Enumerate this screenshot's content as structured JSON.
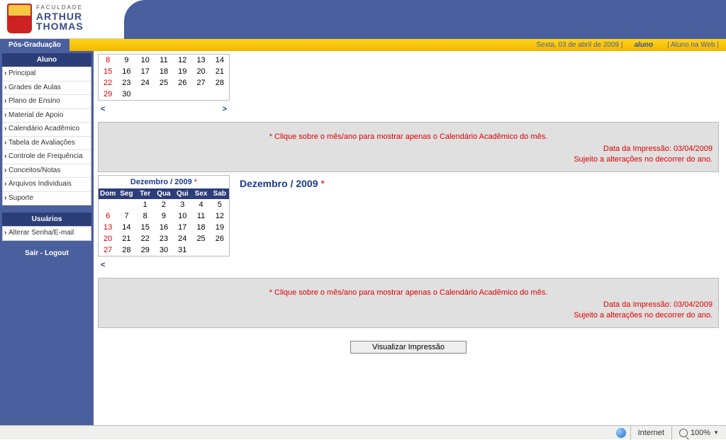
{
  "brand": {
    "small": "FACULDADE",
    "line1": "ARTHUR",
    "line2": "THOMAS"
  },
  "section_label": "Pós-Graduação",
  "topbar": {
    "date": "Sexta, 03 de abril de 2009 |",
    "aluno_tag": "aluno",
    "aluno_web": "| Aluno na Web |"
  },
  "sidebar": {
    "blocks": [
      {
        "title": "Aluno",
        "items": [
          "Principal",
          "Grades de Aulas",
          "Plano de Ensino",
          "Material de Apoio",
          "Calendário Acadêmico",
          "Tabela de Avaliações",
          "Controle de Frequência",
          "Conceitos/Notas",
          "Arquivos Individuais",
          "Suporte"
        ]
      },
      {
        "title": "Usuários",
        "items": [
          "Alterar Senha/E-mail"
        ]
      }
    ],
    "logout": "Sair - Logout"
  },
  "cal1": {
    "weeks": [
      [
        "8",
        "9",
        "10",
        "11",
        "12",
        "13",
        "14"
      ],
      [
        "15",
        "16",
        "17",
        "18",
        "19",
        "20",
        "21"
      ],
      [
        "22",
        "23",
        "24",
        "25",
        "26",
        "27",
        "28"
      ],
      [
        "29",
        "30",
        "",
        "",
        "",
        "",
        ""
      ]
    ]
  },
  "nav_prev": "<",
  "nav_next": ">",
  "notice": {
    "click": "* Clique sobre o mês/ano para mostrar apenas o Calendário Acadêmico do mês.",
    "imp": "Data da Impressão: 03/04/2009",
    "alt": "Sujeito a alterações no decorrer do ano."
  },
  "cal2": {
    "title": "Dezembro / 2009",
    "star": "*",
    "dow": [
      "Dom",
      "Seg",
      "Ter",
      "Qua",
      "Qui",
      "Sex",
      "Sab"
    ],
    "weeks": [
      [
        "",
        "",
        "1",
        "2",
        "3",
        "4",
        "5"
      ],
      [
        "6",
        "7",
        "8",
        "9",
        "10",
        "11",
        "12"
      ],
      [
        "13",
        "14",
        "15",
        "16",
        "17",
        "18",
        "19"
      ],
      [
        "20",
        "21",
        "22",
        "23",
        "24",
        "25",
        "26"
      ],
      [
        "27",
        "28",
        "29",
        "30",
        "31",
        "",
        ""
      ]
    ]
  },
  "detail_title": "Dezembro / 2009",
  "detail_star": "*",
  "print_btn": "Visualizar Impressão",
  "status": {
    "zone": "Internet",
    "zoom": "100%"
  }
}
